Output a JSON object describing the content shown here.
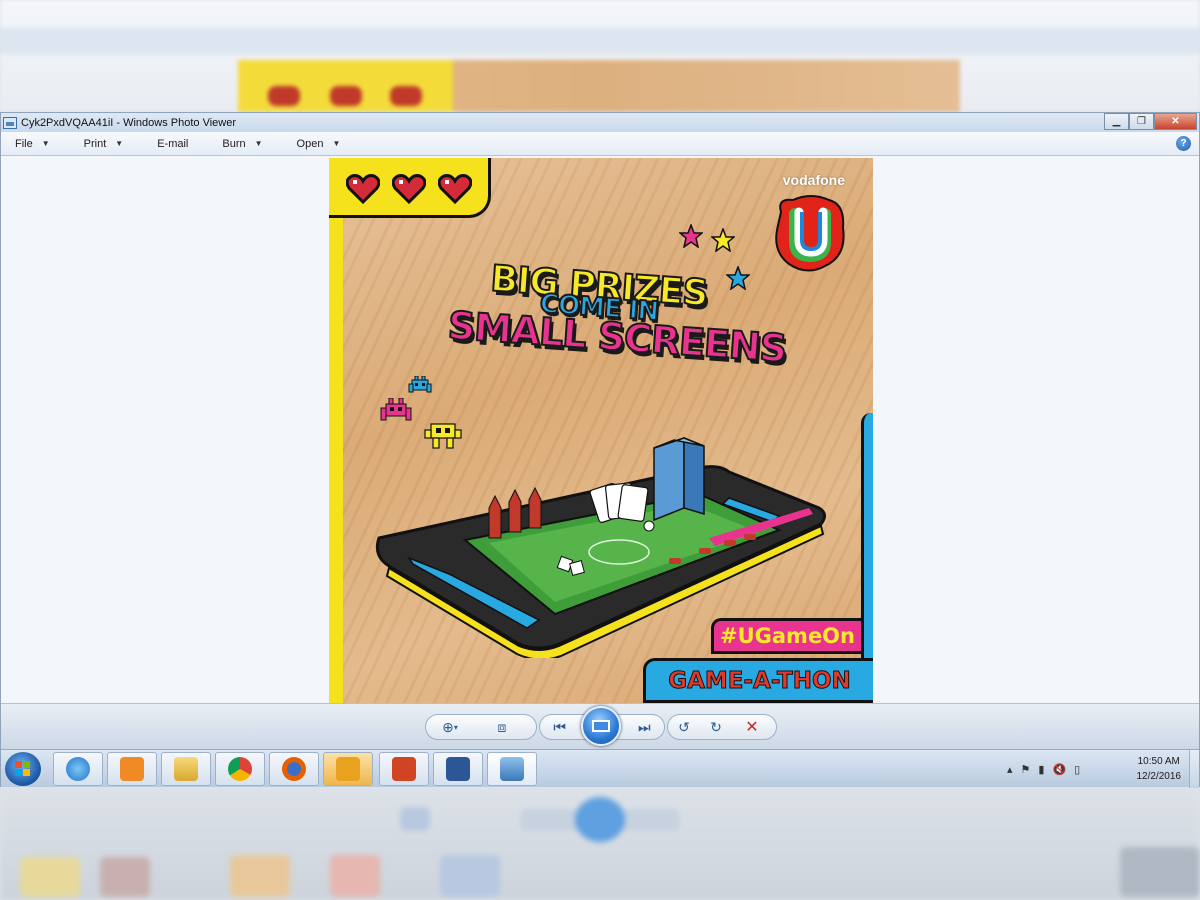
{
  "window": {
    "title": "Cyk2PxdVQAA41iI - Windows Photo Viewer"
  },
  "menus": [
    {
      "label": "File"
    },
    {
      "label": "Print"
    },
    {
      "label": "E-mail"
    },
    {
      "label": "Burn"
    },
    {
      "label": "Open"
    }
  ],
  "poster": {
    "brand": "vodafone",
    "logo_letter": "U",
    "headline_line1": "BIG PRIZES",
    "headline_line2": "COME IN",
    "headline_line3": "SMALL SCREENS",
    "hashtag": "#UGameOn",
    "event": "GAME-A-THON",
    "colors": {
      "yellow": "#f5e21c",
      "pink": "#e8348f",
      "blue": "#29a9e1",
      "red": "#e23a2a"
    }
  },
  "controls": {
    "icons": [
      "zoom-icon",
      "actual-size-icon",
      "previous-icon",
      "slideshow-icon",
      "next-icon",
      "rotate-counterclockwise-icon",
      "rotate-clockwise-icon",
      "delete-icon"
    ]
  },
  "taskbar": {
    "apps": [
      "internet-explorer",
      "media-player",
      "file-explorer",
      "chrome",
      "firefox",
      "outlook",
      "powerpoint",
      "word",
      "photo-viewer"
    ],
    "time": "10:50 AM",
    "date": "12/2/2016"
  }
}
